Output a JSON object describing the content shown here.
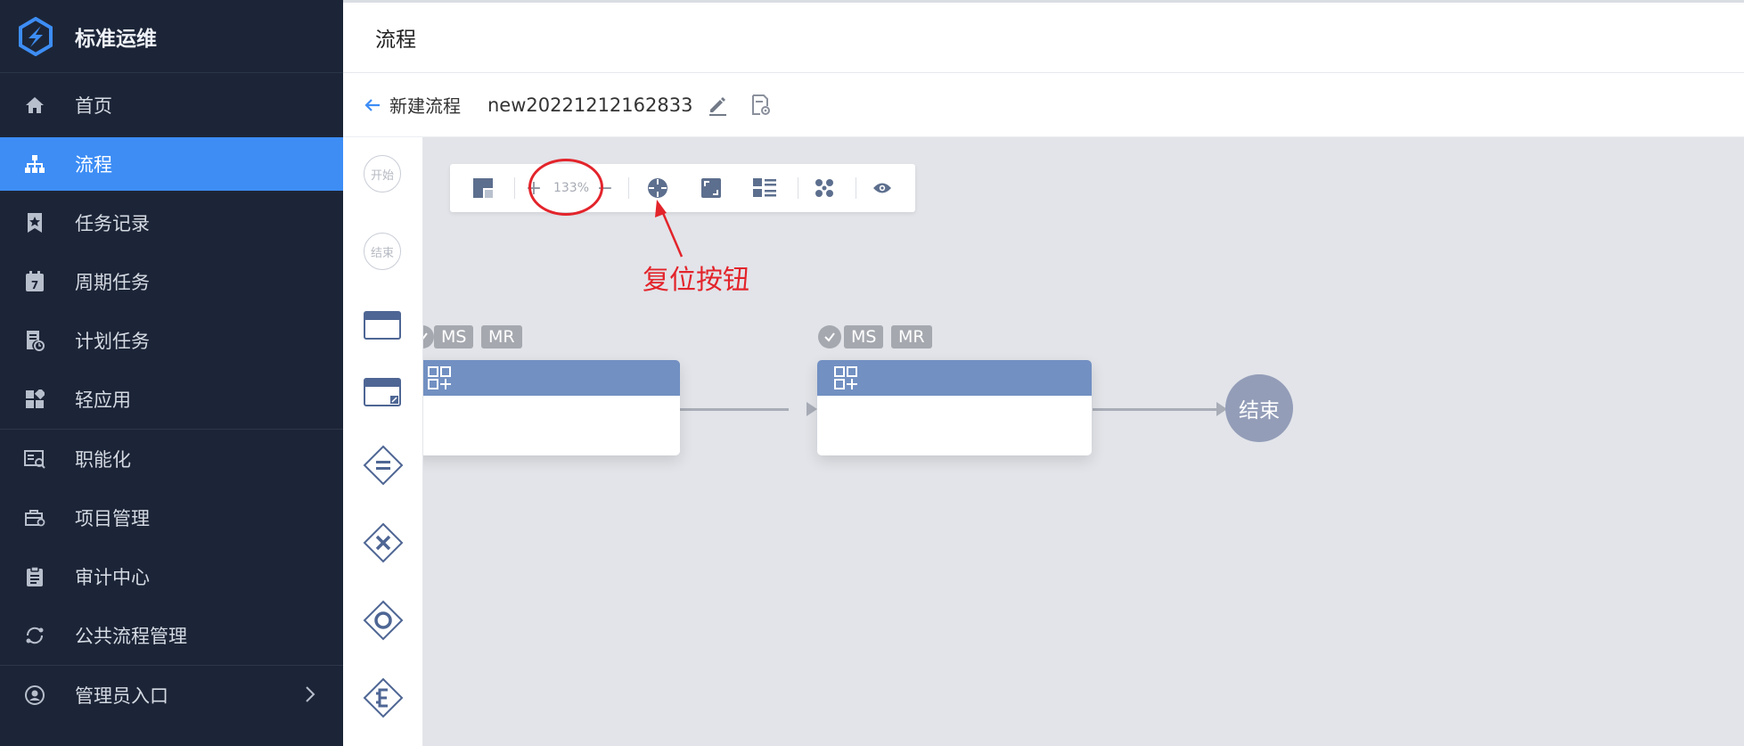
{
  "app": {
    "name": "标准运维"
  },
  "sidebar": {
    "items": [
      {
        "label": "首页",
        "icon": "home-icon"
      },
      {
        "label": "流程",
        "icon": "flow-icon",
        "active": true
      },
      {
        "label": "任务记录",
        "icon": "star-doc-icon"
      },
      {
        "label": "周期任务",
        "icon": "calendar-icon"
      },
      {
        "label": "计划任务",
        "icon": "clock-doc-icon"
      },
      {
        "label": "轻应用",
        "icon": "apps-icon"
      },
      {
        "label": "职能化",
        "icon": "id-card-icon"
      },
      {
        "label": "项目管理",
        "icon": "briefcase-icon"
      },
      {
        "label": "审计中心",
        "icon": "clipboard-icon"
      },
      {
        "label": "公共流程管理",
        "icon": "cycle-icon"
      },
      {
        "label": "管理员入口",
        "icon": "user-circle-icon"
      }
    ],
    "calendar_day": "7"
  },
  "header": {
    "title": "流程"
  },
  "subheader": {
    "back_label": "新建流程",
    "flow_name": "new20221212162833"
  },
  "palette": {
    "start_label": "开始",
    "end_label": "结束"
  },
  "toolbar": {
    "zoom": "133%",
    "zoom_in": "+",
    "zoom_out": "−"
  },
  "annotation": {
    "label": "复位按钮",
    "color": "#e3242b"
  },
  "canvas": {
    "nodes": [
      {
        "badges": [
          "MS",
          "MR"
        ]
      },
      {
        "badges": [
          "MS",
          "MR"
        ]
      }
    ],
    "end_label": "结束"
  },
  "colors": {
    "sidebar_bg": "#1c2537",
    "active": "#3d8df5",
    "node_header": "#7290c2",
    "canvas_bg": "#e2e4e9"
  }
}
